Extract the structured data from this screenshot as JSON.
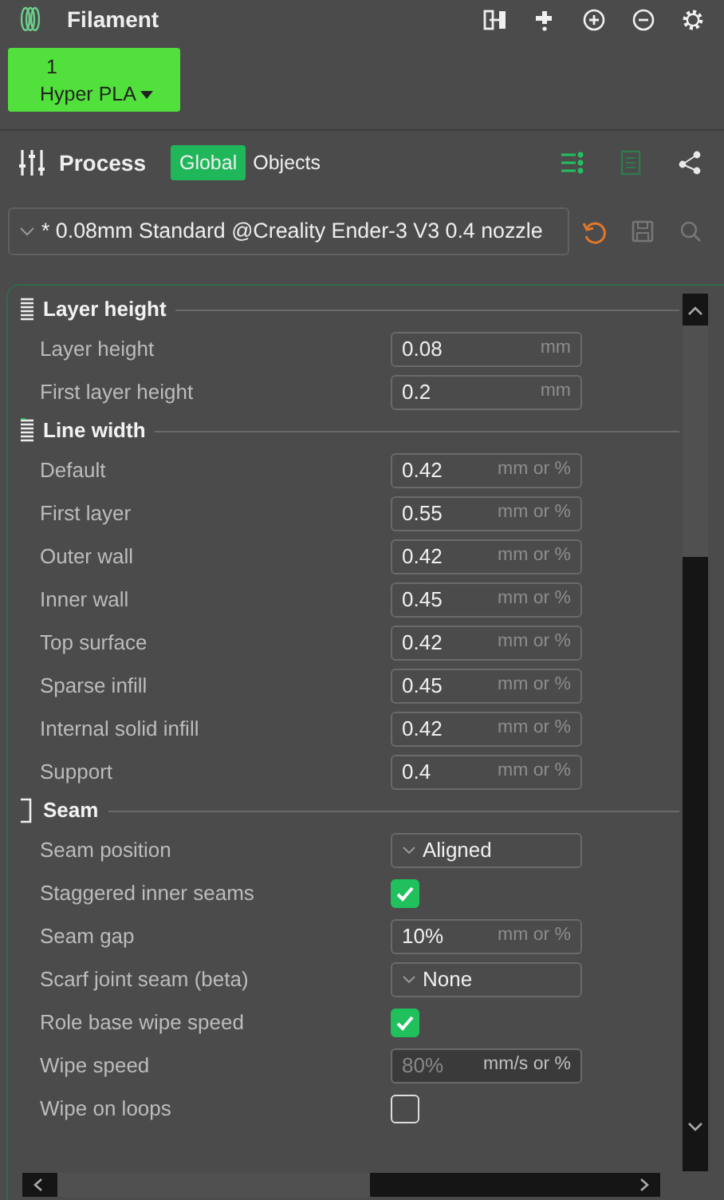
{
  "filament": {
    "title": "Filament",
    "slots": [
      {
        "number": "1",
        "name": "Hyper PLA",
        "color": "#52e03c"
      }
    ]
  },
  "process": {
    "title": "Process",
    "tabs": [
      {
        "label": "Global",
        "selected": true
      },
      {
        "label": "Objects",
        "selected": false
      }
    ],
    "views": [
      {
        "selected": true
      },
      {
        "selected": false
      },
      {
        "selected": false
      }
    ]
  },
  "preset": {
    "value": "* 0.08mm Standard @Creality Ender-3 V3 0.4 nozzle",
    "modified": true
  },
  "sections": [
    {
      "title": "Layer height",
      "kind": "layers",
      "options": [
        {
          "kind": "input",
          "label": "Layer height",
          "value": "0.08",
          "unit": "mm",
          "disabled": false
        },
        {
          "kind": "input",
          "label": "First layer height",
          "value": "0.2",
          "unit": "mm",
          "disabled": false
        }
      ]
    },
    {
      "title": "Line width",
      "kind": "width",
      "options": [
        {
          "kind": "input",
          "label": "Default",
          "value": "0.42",
          "unit": "mm or %",
          "disabled": false
        },
        {
          "kind": "input",
          "label": "First layer",
          "value": "0.55",
          "unit": "mm or %",
          "disabled": false
        },
        {
          "kind": "input",
          "label": "Outer wall",
          "value": "0.42",
          "unit": "mm or %",
          "disabled": false
        },
        {
          "kind": "input",
          "label": "Inner wall",
          "value": "0.45",
          "unit": "mm or %",
          "disabled": false
        },
        {
          "kind": "input",
          "label": "Top surface",
          "value": "0.42",
          "unit": "mm or %",
          "disabled": false
        },
        {
          "kind": "input",
          "label": "Sparse infill",
          "value": "0.45",
          "unit": "mm or %",
          "disabled": false
        },
        {
          "kind": "input",
          "label": "Internal solid infill",
          "value": "0.42",
          "unit": "mm or %",
          "disabled": false
        },
        {
          "kind": "input",
          "label": "Support",
          "value": "0.4",
          "unit": "mm or %",
          "disabled": false
        }
      ]
    },
    {
      "title": "Seam",
      "kind": "seam",
      "options": [
        {
          "kind": "select",
          "label": "Seam position",
          "value": "Aligned"
        },
        {
          "kind": "checkbox",
          "label": "Staggered inner seams",
          "checked": true
        },
        {
          "kind": "input",
          "label": "Seam gap",
          "value": "10%",
          "unit": "mm or %",
          "disabled": false
        },
        {
          "kind": "select",
          "label": "Scarf joint seam (beta)",
          "value": "None"
        },
        {
          "kind": "checkbox",
          "label": "Role base wipe speed",
          "checked": true
        },
        {
          "kind": "input",
          "label": "Wipe speed",
          "value": "80%",
          "unit": "mm/s or %",
          "disabled": true
        },
        {
          "kind": "checkbox",
          "label": "Wipe on loops",
          "checked": false
        }
      ]
    }
  ]
}
